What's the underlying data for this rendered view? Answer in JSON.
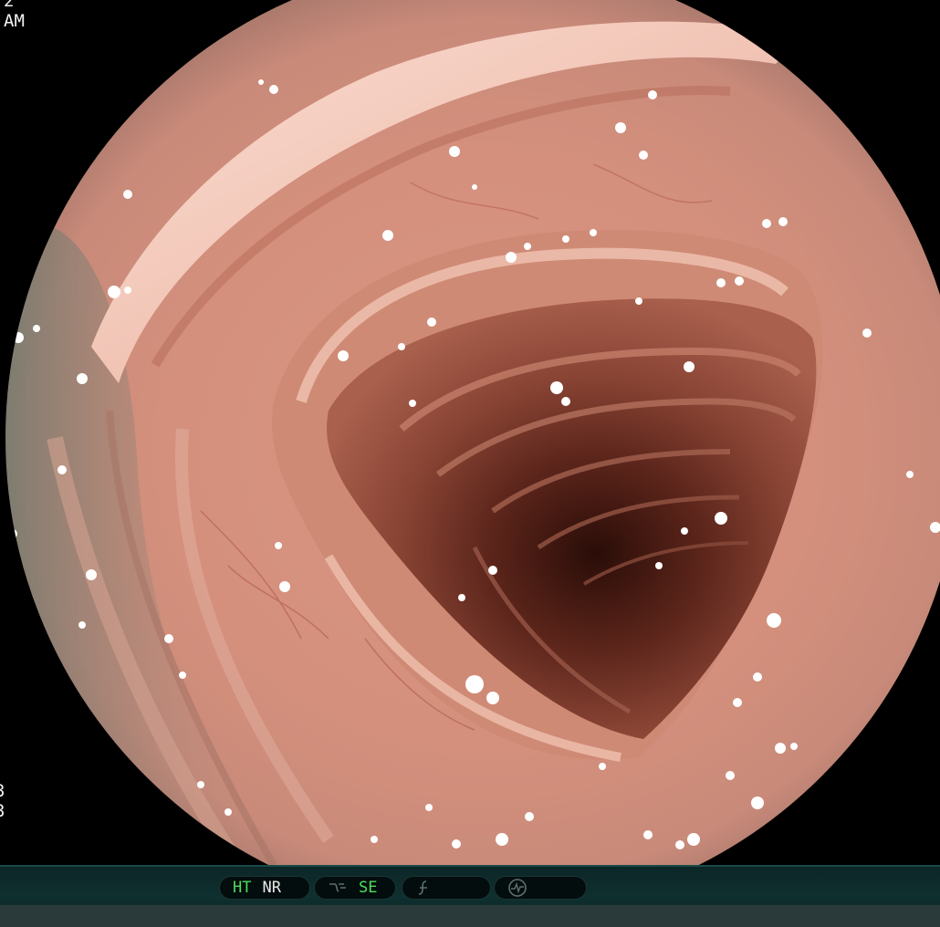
{
  "osd": {
    "top_lines": "2\nAM",
    "bottom_lines": "3\n3"
  },
  "status_bar": {
    "ht_label": "HT",
    "nr_label": "NR",
    "se_label": "SE",
    "ht_color": "#4fdc5a",
    "se_color": "#4fdc5a",
    "icons": [
      "enhancement-mode-icon",
      "freeze-icon",
      "waveform-icon"
    ]
  },
  "image": {
    "subject": "endoscopic view of colon lumen",
    "palette": [
      "#e6a796",
      "#c57a68",
      "#8b4a3c",
      "#4a1f17",
      "#1a0805"
    ]
  }
}
